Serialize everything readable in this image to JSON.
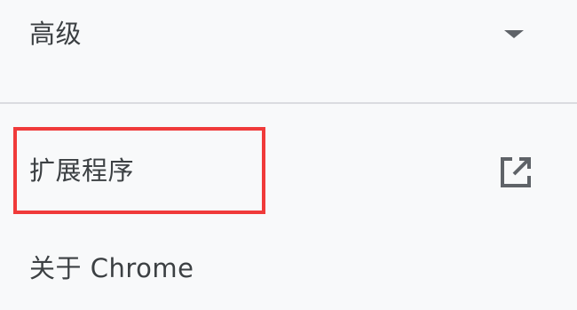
{
  "menu": {
    "advanced": {
      "label": "高级",
      "icon": "caret-down-icon"
    },
    "extensions": {
      "label": "扩展程序",
      "icon": "external-link-icon"
    },
    "about": {
      "label": "关于 Chrome"
    }
  },
  "annotation": {
    "highlight_color": "#f03a3a",
    "highlighted_item": "extensions"
  },
  "colors": {
    "background": "#f8f9fa",
    "text": "#3c4043",
    "icon": "#5f6368",
    "divider": "#dadce0"
  }
}
